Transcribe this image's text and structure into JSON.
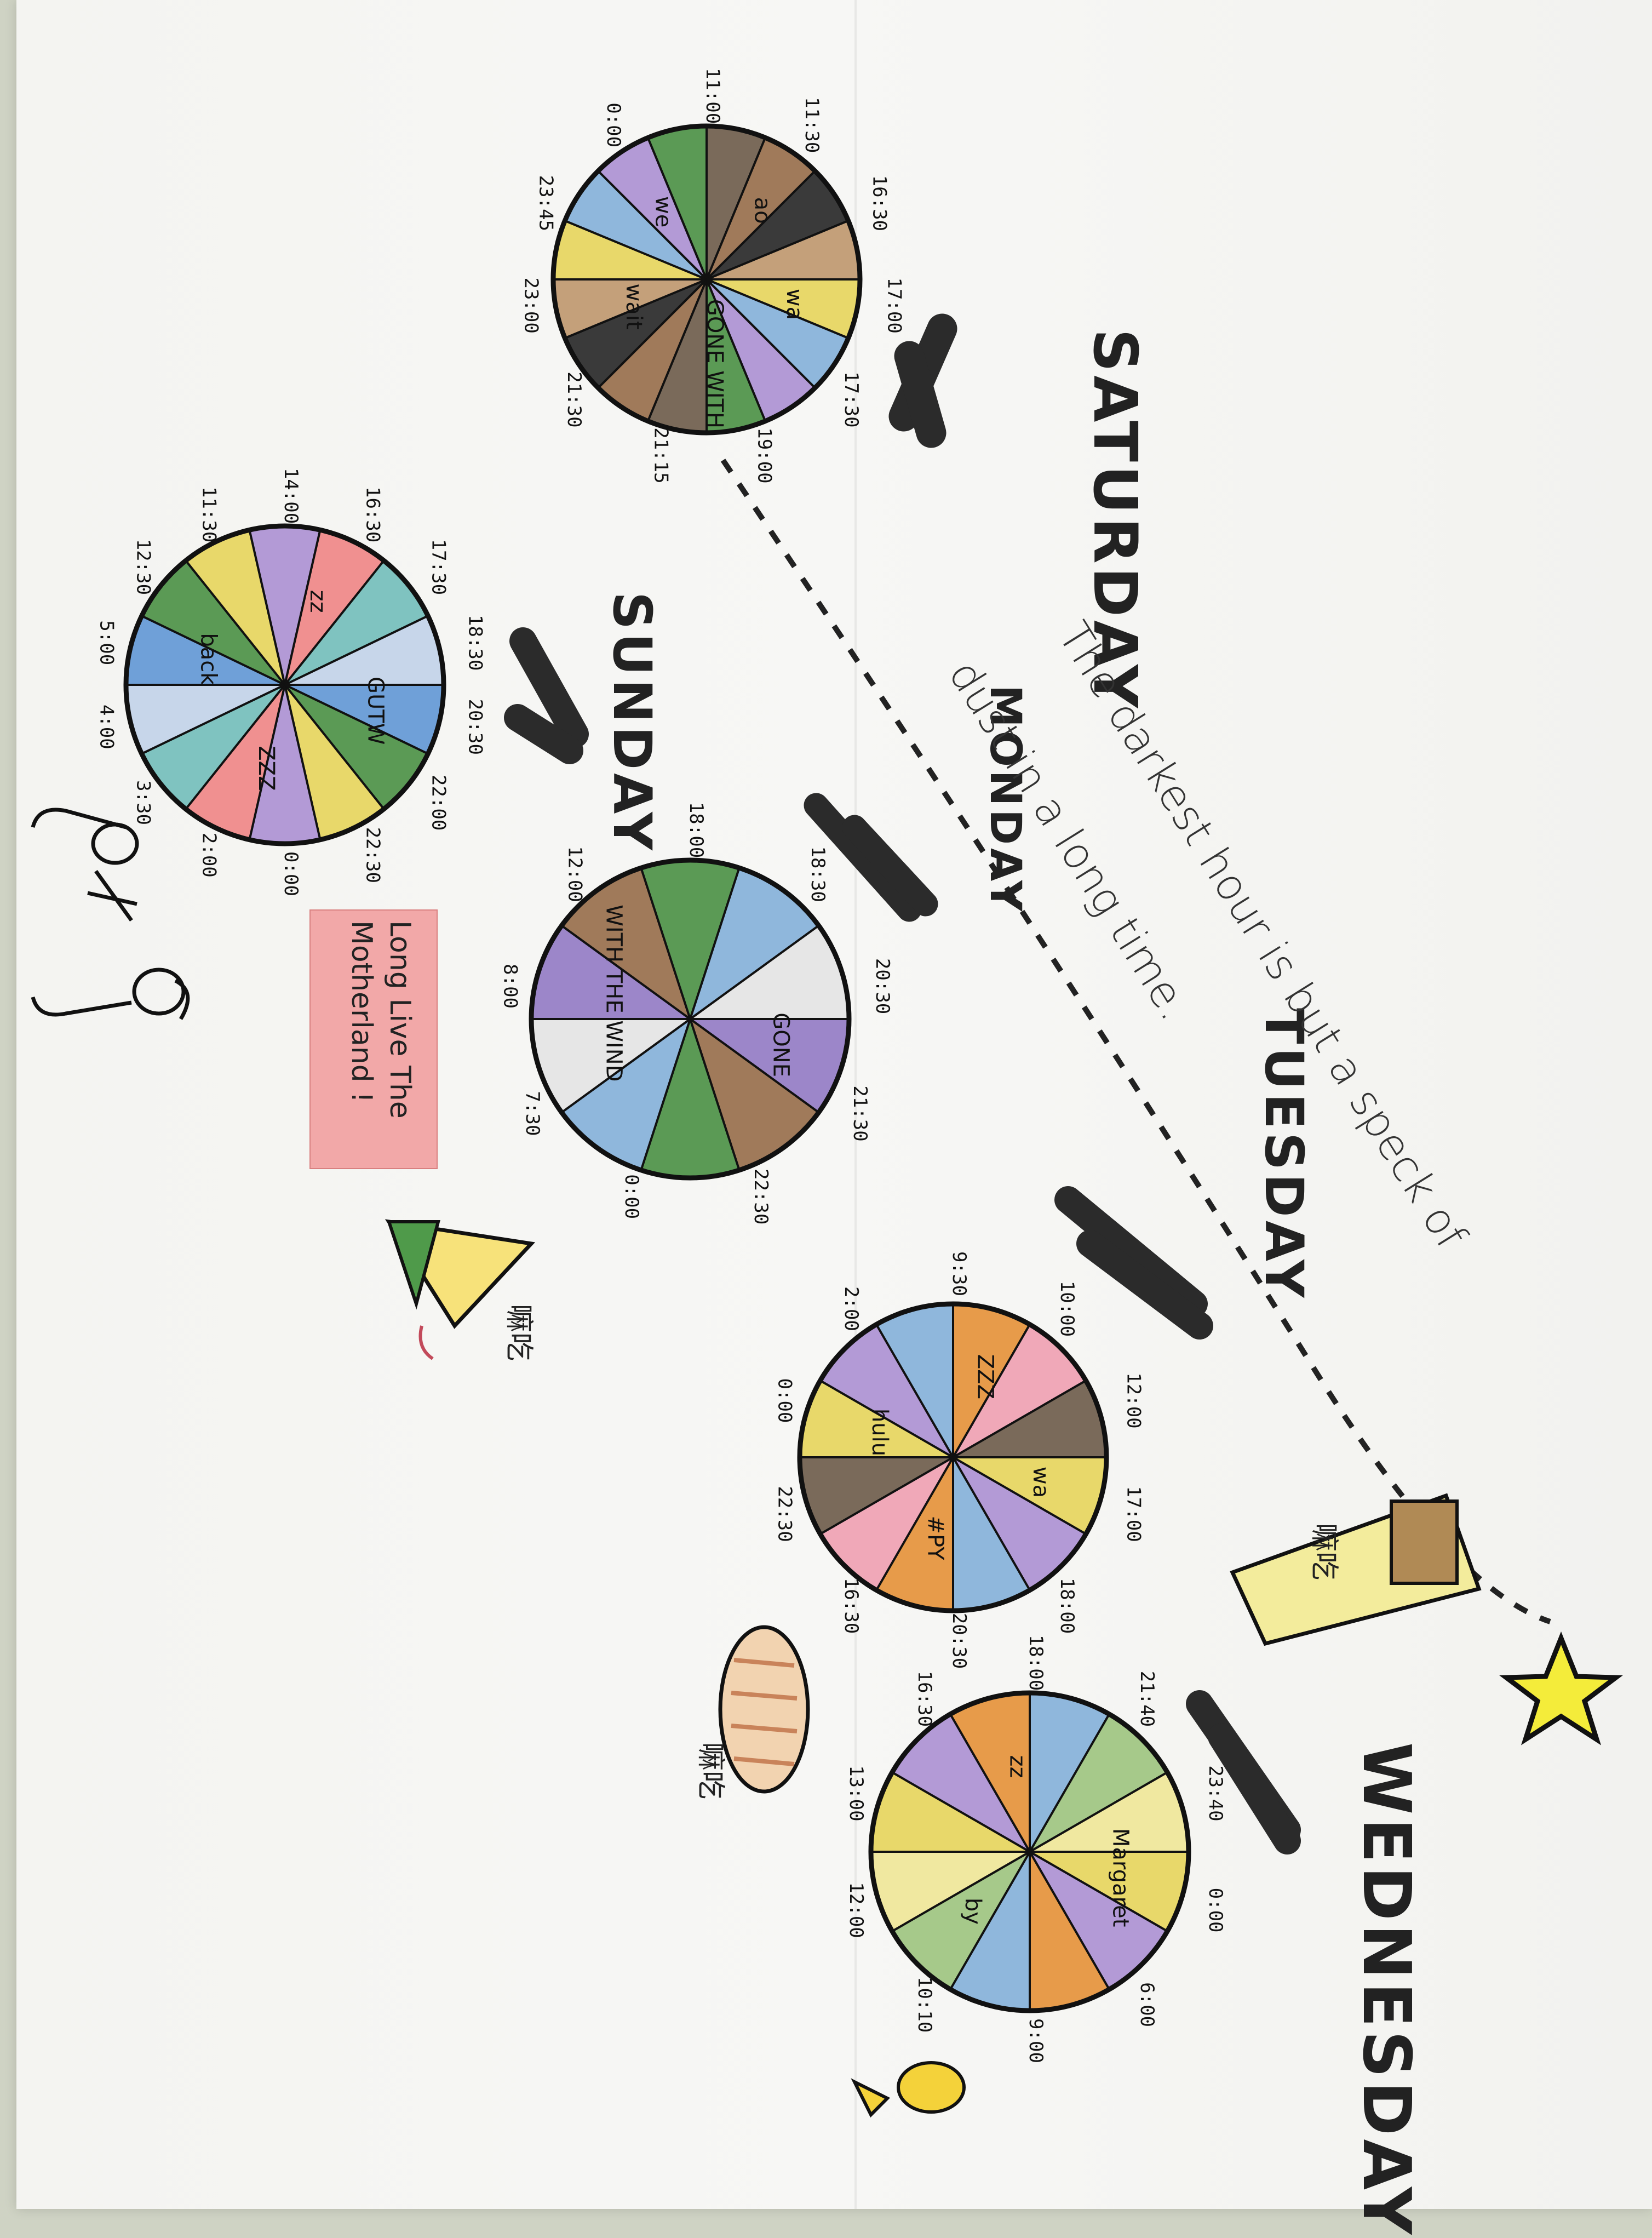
{
  "days": {
    "saturday": "SATURDAY",
    "sunday": "SUNDAY",
    "monday": "MONDAY",
    "tuesday": "TUESDAY",
    "wednesday": "WEDNESDAY"
  },
  "quote": {
    "line1": "The darkest hour is but a speck of",
    "line2": "dust in a long time."
  },
  "sign": {
    "line1": "Long Live The",
    "line2": "Motherland !"
  },
  "saturday_wheel": {
    "times": [
      "11:00",
      "11:30",
      "16:30",
      "17:00",
      "17:30",
      "19:00",
      "21:15",
      "21:30",
      "23:00",
      "23:45",
      "0:00"
    ],
    "segment_text": [
      "wa",
      "GONE WITH",
      "wait",
      "we",
      "ao"
    ],
    "colors": [
      "#e8d86a",
      "#8fb7dc",
      "#b39ad6",
      "#5b9a55",
      "#7a6a5a",
      "#a07a5a",
      "#3a3a3a",
      "#c4a07a"
    ]
  },
  "sunday_wheel": {
    "times": [
      "14:00",
      "16:30",
      "17:30",
      "18:30",
      "20:30",
      "22:00",
      "22:30",
      "0:00",
      "2:00",
      "3:30",
      "4:00",
      "5:00",
      "12:30",
      "11:30"
    ],
    "segment_text": [
      "GUTW",
      "ZZZ",
      "back",
      "zz"
    ],
    "colors": [
      "#6fa0d8",
      "#5b9a55",
      "#e8d86a",
      "#b39ad6",
      "#f09090",
      "#7fc3c0",
      "#c7d6ea"
    ]
  },
  "monday_wheel": {
    "times": [
      "18:00",
      "18:30",
      "20:30",
      "21:30",
      "22:30",
      "0:00",
      "7:30",
      "8:00",
      "12:00"
    ],
    "segment_text": [
      "GONE",
      "WITH THE WIND"
    ],
    "colors": [
      "#9c86c9",
      "#a07a5a",
      "#5b9a55",
      "#8fb7dc",
      "#e6e6e6"
    ]
  },
  "tuesday_wheel": {
    "times": [
      "9:30",
      "10:00",
      "12:00",
      "17:00",
      "18:00",
      "20:30",
      "16:30",
      "22:30",
      "0:00",
      "2:00"
    ],
    "segment_text": [
      "wa",
      "#PY",
      "hulu",
      "ZZZ"
    ],
    "colors": [
      "#e8d86a",
      "#b39ad6",
      "#8fb7dc",
      "#e79b4a",
      "#f0a8b8",
      "#7a6a5a"
    ]
  },
  "wednesday_wheel": {
    "times": [
      "18:00",
      "21:40",
      "23:40",
      "0:00",
      "6:00",
      "9:00",
      "10:10",
      "12:00",
      "13:00",
      "16:30"
    ],
    "segment_text": [
      "Margaret",
      "by",
      "zz"
    ],
    "colors": [
      "#e8d86a",
      "#b39ad6",
      "#e79b4a",
      "#8fb7dc",
      "#a6c98a",
      "#f0e8a0"
    ]
  },
  "snacks": {
    "monday": "嘛吃",
    "tuesday": "嘛吃",
    "wednesday": "嘛吃"
  },
  "colors": {
    "star": "#f4ec3a",
    "arrow": "#2b2b2b",
    "ink": "#111111",
    "paper": "#f5f5f2"
  },
  "icons": [
    "star-icon",
    "headphones-icon",
    "rice-dumpling-icon",
    "takeaway-bag-icon",
    "bread-icon",
    "money-bag-icon",
    "microphone-icon"
  ]
}
